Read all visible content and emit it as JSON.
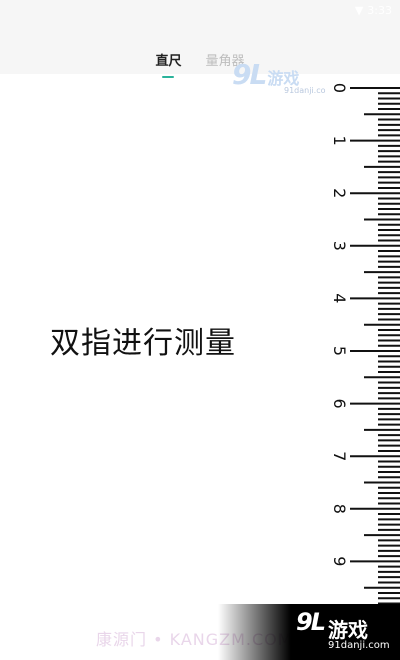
{
  "status_bar": {
    "time": "3:33"
  },
  "tabs": [
    {
      "label": "直尺",
      "active": true
    },
    {
      "label": "量角器",
      "active": false
    }
  ],
  "instruction": "双指进行测量",
  "ruler": {
    "labels": [
      "0",
      "1",
      "2",
      "3",
      "4",
      "5",
      "6",
      "7",
      "8",
      "9"
    ],
    "unit_cm": true
  },
  "watermarks": {
    "top_logo": "9L",
    "top_cn": "游戏",
    "top_site": "91danji.com",
    "bottom_logo": "9L",
    "bottom_cn": "游戏",
    "bottom_site": "91danji.com",
    "kangzm": "康源门 • KANGZM.COM"
  },
  "colors": {
    "accent": "#2bb39b"
  }
}
